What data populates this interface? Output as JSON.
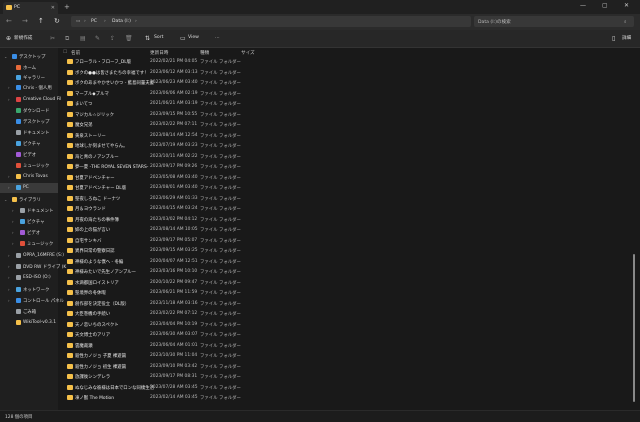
{
  "window": {
    "tab_title": "PC",
    "new_tab_icon": "plus-icon",
    "minimize": "—",
    "maximize": "▢",
    "close": "✕"
  },
  "address": {
    "back": "←",
    "forward": "→",
    "up": "↑",
    "refresh": "↻",
    "crumbs": [
      "PC",
      "Data (I:)"
    ],
    "search_placeholder": "Data (I:)の検索"
  },
  "toolbar": {
    "new_label": "新規作成",
    "sort_label": "Sort",
    "view_label": "View",
    "more": "…",
    "details_label": "詳細"
  },
  "sidebar": {
    "items": [
      {
        "label": "デスクトップ",
        "color": "#3a8ee6"
      },
      {
        "label": "ホーム",
        "color": "#e66a3a"
      },
      {
        "label": "ギャラリー",
        "color": "#4aa3df"
      },
      {
        "label": "Chris - 個人用",
        "color": "#3a8ee6"
      },
      {
        "label": "Creative Cloud Fil",
        "color": "#d44"
      },
      {
        "label": "ダウンロード",
        "color": "#3aa86e"
      },
      {
        "label": "デスクトップ",
        "color": "#3a8ee6"
      },
      {
        "label": "ドキュメント",
        "color": "#9aa0a6"
      },
      {
        "label": "ピクチャ",
        "color": "#4aa3df"
      },
      {
        "label": "ビデオ",
        "color": "#a25ad6"
      },
      {
        "label": "ミュージック",
        "color": "#e0503a"
      },
      {
        "label": "Chris Tovas",
        "color": "#f5c04a"
      },
      {
        "label": "PC",
        "color": "#4aa3df"
      },
      {
        "label": "ライブラリ",
        "color": "#f5c04a"
      },
      {
        "label": "ドキュメント",
        "color": "#9aa0a6"
      },
      {
        "label": "ピクチャ",
        "color": "#4aa3df"
      },
      {
        "label": "ビデオ",
        "color": "#a25ad6"
      },
      {
        "label": "ミュージック",
        "color": "#e0503a"
      },
      {
        "label": "OPRA_16MFRE (S:)",
        "color": "#9aa0a6"
      },
      {
        "label": "DVD RW ドライブ (K",
        "color": "#9aa0a6"
      },
      {
        "label": "ESD-ISO (O:)",
        "color": "#9aa0a6"
      },
      {
        "label": "ネットワーク",
        "color": "#4aa3df"
      },
      {
        "label": "コントロール パネル",
        "color": "#3a8ee6"
      },
      {
        "label": "ごみ箱",
        "color": "#9aa0a6"
      },
      {
        "label": "WikiTool-v0.3.1",
        "color": "#f5c04a"
      }
    ]
  },
  "columns": {
    "name": "名前",
    "date": "更新日時",
    "type": "種類",
    "size": "サイズ"
  },
  "files": [
    {
      "name": "フローラル・フローフ_DL版",
      "date": "2022/02/21 PM 04:05",
      "type": "ファイル フォルダー"
    },
    {
      "name": "ボクの●●は皆さまたちの幸福です！",
      "date": "2023/06/12 AM 03:13",
      "type": "ファイル フォルダー"
    },
    {
      "name": "ボクのあまやかせいかつ - 藍島同輩夫妻 -",
      "date": "2023/06/23 AM 03:40",
      "type": "ファイル フォルダー"
    },
    {
      "name": "マーブル◆ブルマ",
      "date": "2023/06/06 AM 02:19",
      "type": "ファイル フォルダー"
    },
    {
      "name": "まいてつ",
      "date": "2021/06/21 AM 03:19",
      "type": "ファイル フォルダー"
    },
    {
      "name": "マジカル☆ジリック",
      "date": "2023/09/15 PM 10:55",
      "type": "ファイル フォルダー"
    },
    {
      "name": "魔女兄弟",
      "date": "2023/02/22 PM 07:11",
      "type": "ファイル フォルダー"
    },
    {
      "name": "黄泉ストーリー",
      "date": "2023/08/14 AM 12:54",
      "type": "ファイル フォルダー"
    },
    {
      "name": "地球しか刻ませてやらん。",
      "date": "2023/07/19 AM 03:23",
      "type": "ファイル フォルダー"
    },
    {
      "name": "海と青のノアンブルー",
      "date": "2023/10/11 AM 02:22",
      "type": "ファイル フォルダー"
    },
    {
      "name": "夢一夏 -THE ROYAL SEVEN STARS-",
      "date": "2023/09/17 PM 09:26",
      "type": "ファイル フォルダー"
    },
    {
      "name": "甘夏アドベンチャー",
      "date": "2023/05/08 AM 03:40",
      "type": "ファイル フォルダー"
    },
    {
      "name": "甘夏アドベンチャー DL版",
      "date": "2023/08/01 AM 03:40",
      "type": "ファイル フォルダー"
    },
    {
      "name": "聖夜しろねこ ドーナツ",
      "date": "2023/06/29 AM 01:33",
      "type": "ファイル フォルダー"
    },
    {
      "name": "月＆ヨウランド",
      "date": "2023/04/15 AM 03:24",
      "type": "ファイル フォルダー"
    },
    {
      "name": "月夜の海たちの事件簿",
      "date": "2023/03/02 PM 04:12",
      "type": "ファイル フォルダー"
    },
    {
      "name": "姉の上の猫が言い",
      "date": "2023/08/14 AM 10:05",
      "type": "ファイル フォルダー"
    },
    {
      "name": "自宅サンキバ",
      "date": "2023/09/17 PM 05:07",
      "type": "ファイル フォルダー"
    },
    {
      "name": "異界日常の警察日誌",
      "date": "2023/09/15 AM 03:25",
      "type": "ファイル フォルダー"
    },
    {
      "name": "神様のような僕へ - 冬編",
      "date": "2020/04/07 AM 12:51",
      "type": "ファイル フォルダー"
    },
    {
      "name": "神様みたいで先生ノアンブルー",
      "date": "2023/03/16 PM 10:10",
      "type": "ファイル フォルダー"
    },
    {
      "name": "水滴都国ロイストリア",
      "date": "2020/10/22 PM 09:47",
      "type": "ファイル フォルダー"
    },
    {
      "name": "聖境界の冬休暇",
      "date": "2023/06/21 PM 11:59",
      "type": "ファイル フォルダー"
    },
    {
      "name": "創作部を決定役立（DL版）",
      "date": "2023/11/18 AM 03:16",
      "type": "ファイル フォルダー"
    },
    {
      "name": "大臣巻機の手続い",
      "date": "2023/02/22 PM 07:12",
      "type": "ファイル フォルダー"
    },
    {
      "name": "天ノ恋いちのスペクト",
      "date": "2023/04/04 PM 10:19",
      "type": "ファイル フォルダー"
    },
    {
      "name": "天文博士のアリア",
      "date": "2023/06/30 AM 03:07",
      "type": "ファイル フォルダー"
    },
    {
      "name": "雲魔裁瀬",
      "date": "2023/06/04 AM 01:01",
      "type": "ファイル フォルダー"
    },
    {
      "name": "殺性カノジョ 子夏 裸遊篇",
      "date": "2023/10/30 PM 11:04",
      "type": "ファイル フォルダー"
    },
    {
      "name": "殺性カノジョ 初生 裸遊篇",
      "date": "2023/09/10 PM 03:42",
      "type": "ファイル フォルダー"
    },
    {
      "name": "放課後シンデレラ",
      "date": "2023/09/17 PM 08:31",
      "type": "ファイル フォルダー"
    },
    {
      "name": "ぬなじみな彼様は日本でロンな同棲生活",
      "date": "2023/07/28 AM 03:45",
      "type": "ファイル フォルダー"
    },
    {
      "name": "凍ノ獣 The Motion",
      "date": "2023/02/14 AM 03:45",
      "type": "ファイル フォルダー"
    }
  ],
  "status": {
    "count": "128 個の項目"
  }
}
